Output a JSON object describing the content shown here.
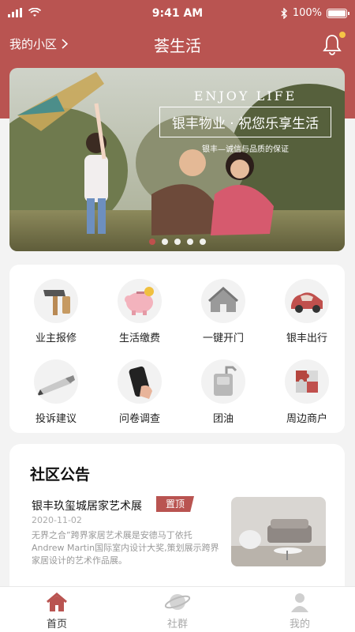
{
  "status_bar": {
    "time": "9:41 AM",
    "battery": "100%",
    "battery_level": 1.0
  },
  "nav": {
    "community_link": "我的小区",
    "title": "荟生活",
    "has_notification": true
  },
  "banner": {
    "heading_en": "ENJOY LIFE",
    "heading": "银丰物业 · 祝您乐享生活",
    "subheading": "银丰—诚信与品质的保证",
    "slide_count": 5,
    "active_slide": 1
  },
  "services": [
    {
      "label": "业主报修",
      "icon": "hammer-icon"
    },
    {
      "label": "生活缴费",
      "icon": "piggy-bank-icon"
    },
    {
      "label": "一键开门",
      "icon": "house-icon"
    },
    {
      "label": "银丰出行",
      "icon": "car-icon"
    },
    {
      "label": "投诉建议",
      "icon": "pen-icon"
    },
    {
      "label": "问卷调查",
      "icon": "phone-icon"
    },
    {
      "label": "团油",
      "icon": "fuel-can-icon"
    },
    {
      "label": "周边商户",
      "icon": "puzzle-icon"
    }
  ],
  "notice": {
    "section_title": "社区公告",
    "item": {
      "title": "银丰玖玺城居家艺术展",
      "badge": "置顶",
      "date": "2020-11-02",
      "body": "无界之合”跨界家居艺术展是安德马丁依托Andrew Martin国际室内设计大奖,策划展示跨界家居设计的艺术作品展。"
    }
  },
  "tabbar": {
    "items": [
      {
        "label": "首页",
        "icon": "home-icon",
        "active": true
      },
      {
        "label": "社群",
        "icon": "planet-icon",
        "active": false
      },
      {
        "label": "我的",
        "icon": "user-icon",
        "active": false
      }
    ]
  },
  "colors": {
    "brand": "#b95451",
    "badge_dot": "#f6c445"
  }
}
